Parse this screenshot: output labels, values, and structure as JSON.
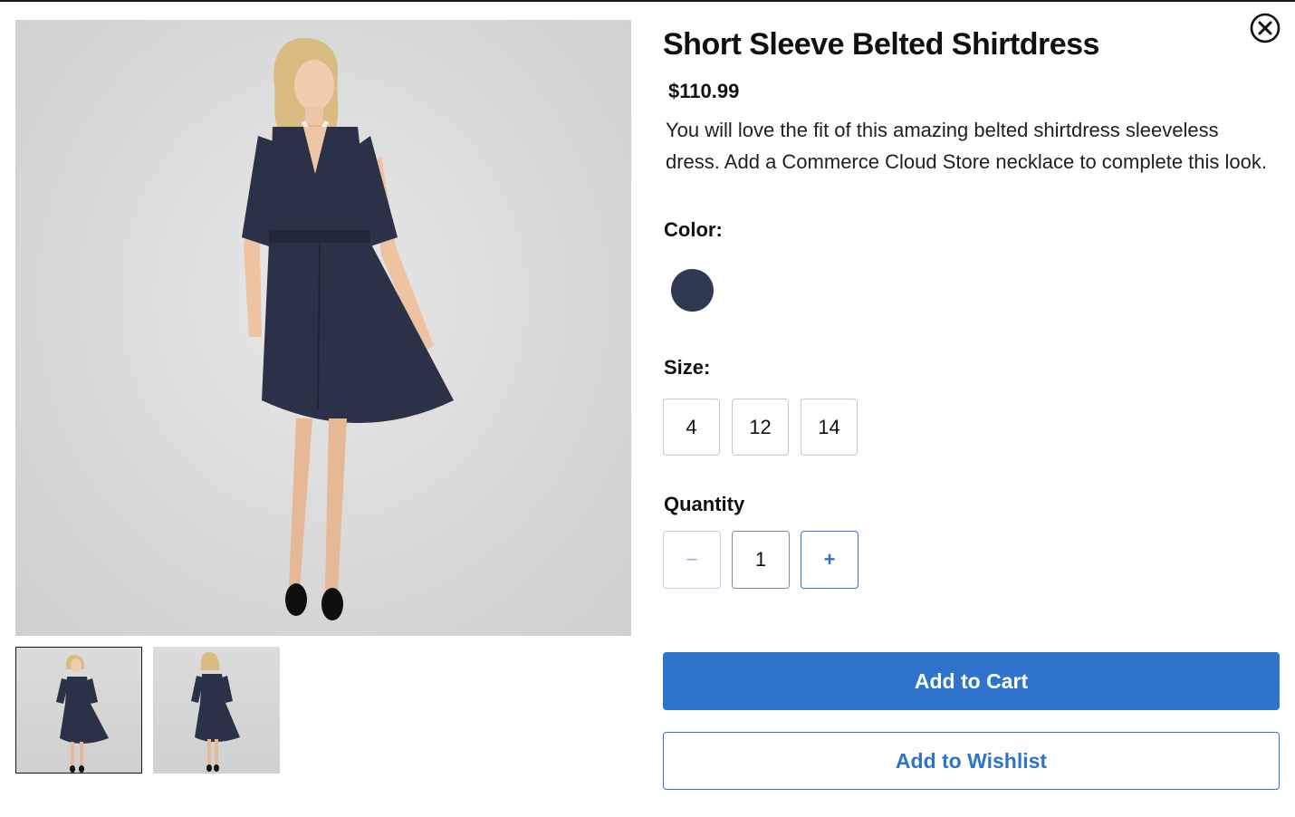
{
  "product": {
    "title": "Short Sleeve Belted Shirtdress",
    "price": "$110.99",
    "description": "You will love the fit of this amazing belted shirtdress sleeveless dress. Add a Commerce Cloud Store necklace to complete this look."
  },
  "gallery": {
    "main_image_icon": "model-front-photo",
    "thumbnails": [
      {
        "icon": "model-front-thumbnail",
        "selected": true
      },
      {
        "icon": "model-back-thumbnail",
        "selected": false
      }
    ]
  },
  "color": {
    "label": "Color:",
    "swatches": [
      {
        "value": "#303952",
        "selected": true
      }
    ]
  },
  "size": {
    "label": "Size:",
    "options": [
      "4",
      "12",
      "14"
    ]
  },
  "quantity": {
    "label": "Quantity",
    "value": "1",
    "decrement_symbol": "−",
    "increment_symbol": "+"
  },
  "actions": {
    "add_to_cart": "Add to Cart",
    "add_to_wishlist": "Add to Wishlist"
  },
  "close_icon": "close-circle-icon",
  "theme": {
    "accent": "#2f73cd",
    "dress": "#2b3248"
  }
}
